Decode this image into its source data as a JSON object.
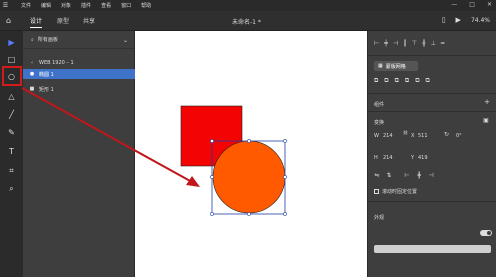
{
  "menubar": {
    "items": [
      "文件",
      "编辑",
      "对象",
      "插件",
      "查看",
      "窗口",
      "帮助"
    ]
  },
  "tabbar": {
    "tabs": [
      "设计",
      "原型",
      "共享"
    ],
    "active_tab": "设计",
    "document_title": "未命名-1 *",
    "zoom": "74.4%"
  },
  "layers": {
    "search_label": "所有画板",
    "artboard_label": "WEB 1920 – 1",
    "items": [
      {
        "label": "椭圆 1",
        "selected": true
      },
      {
        "label": "矩形 1",
        "selected": false
      }
    ]
  },
  "inspector": {
    "mask_button": "蒙版网格",
    "section_components": "组件",
    "section_transform": "变换",
    "w_label": "W",
    "w_value": "214",
    "x_label": "X",
    "x_value": "511",
    "h_label": "H",
    "h_value": "214",
    "y_label": "Y",
    "y_value": "419",
    "rotation_value": "0°",
    "fix_position_label": "滚动时固定位置",
    "section_appearance": "外观"
  },
  "canvas": {
    "colors": {
      "rect_fill": "#f40303",
      "circle_fill": "#ff5a00",
      "selection": "#1f3fa8",
      "annotation": "#c0171b"
    }
  }
}
